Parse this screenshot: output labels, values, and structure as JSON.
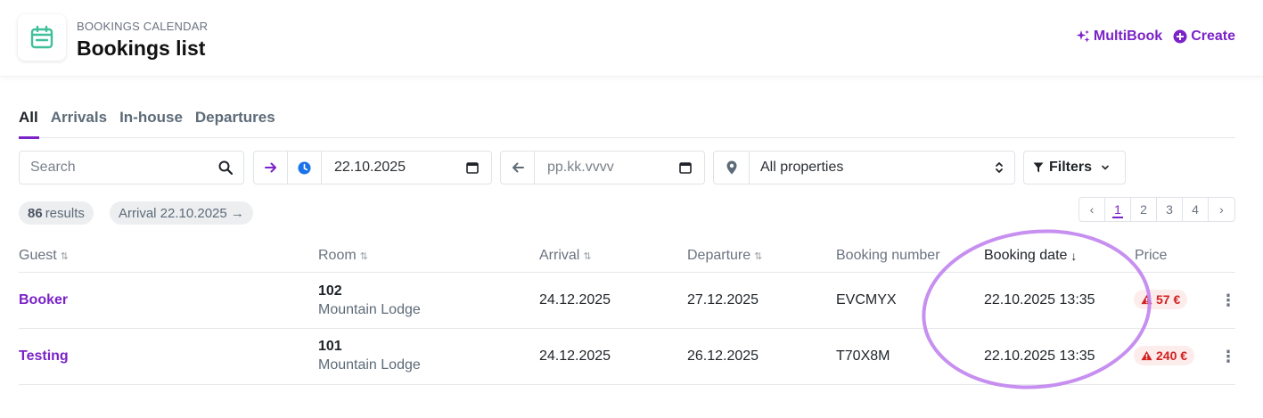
{
  "header": {
    "breadcrumb": "BOOKINGS CALENDAR",
    "title": "Bookings list",
    "app_icon": "calendar-icon",
    "multibook_label": "MultiBook",
    "create_label": "Create"
  },
  "tabs": [
    {
      "label": "All",
      "active": true
    },
    {
      "label": "Arrivals",
      "active": false
    },
    {
      "label": "In-house",
      "active": false
    },
    {
      "label": "Departures",
      "active": false
    }
  ],
  "filters": {
    "search_placeholder": "Search",
    "arrival_date": "22.10.2025",
    "departure_placeholder": "pp.kk.vvvv",
    "property_value": "All properties",
    "filters_label": "Filters"
  },
  "summary": {
    "count": "86",
    "count_suffix": "results",
    "active_filter": "Arrival 22.10.2025 →"
  },
  "pager": {
    "pages": [
      "1",
      "2",
      "3",
      "4"
    ],
    "current": "1"
  },
  "table": {
    "columns": [
      "Guest",
      "Room",
      "Arrival",
      "Departure",
      "Booking number",
      "Booking date",
      "Price"
    ],
    "rows": [
      {
        "guest": "Booker",
        "room_number": "102",
        "room_name": "Mountain Lodge",
        "arrival": "24.12.2025",
        "departure": "27.12.2025",
        "booking_number": "EVCMYX",
        "booking_date": "22.10.2025 13:35",
        "price": "57 €"
      },
      {
        "guest": "Testing",
        "room_number": "101",
        "room_name": "Mountain Lodge",
        "arrival": "24.12.2025",
        "departure": "26.12.2025",
        "booking_number": "T70X8M",
        "booking_date": "22.10.2025 13:35",
        "price": "240 €"
      }
    ]
  },
  "colors": {
    "accent": "#7b22c8",
    "icon_green": "#3fbf9a",
    "clock_blue": "#1a73e8",
    "price_red": "#d42020",
    "annotation": "#c083ee"
  }
}
